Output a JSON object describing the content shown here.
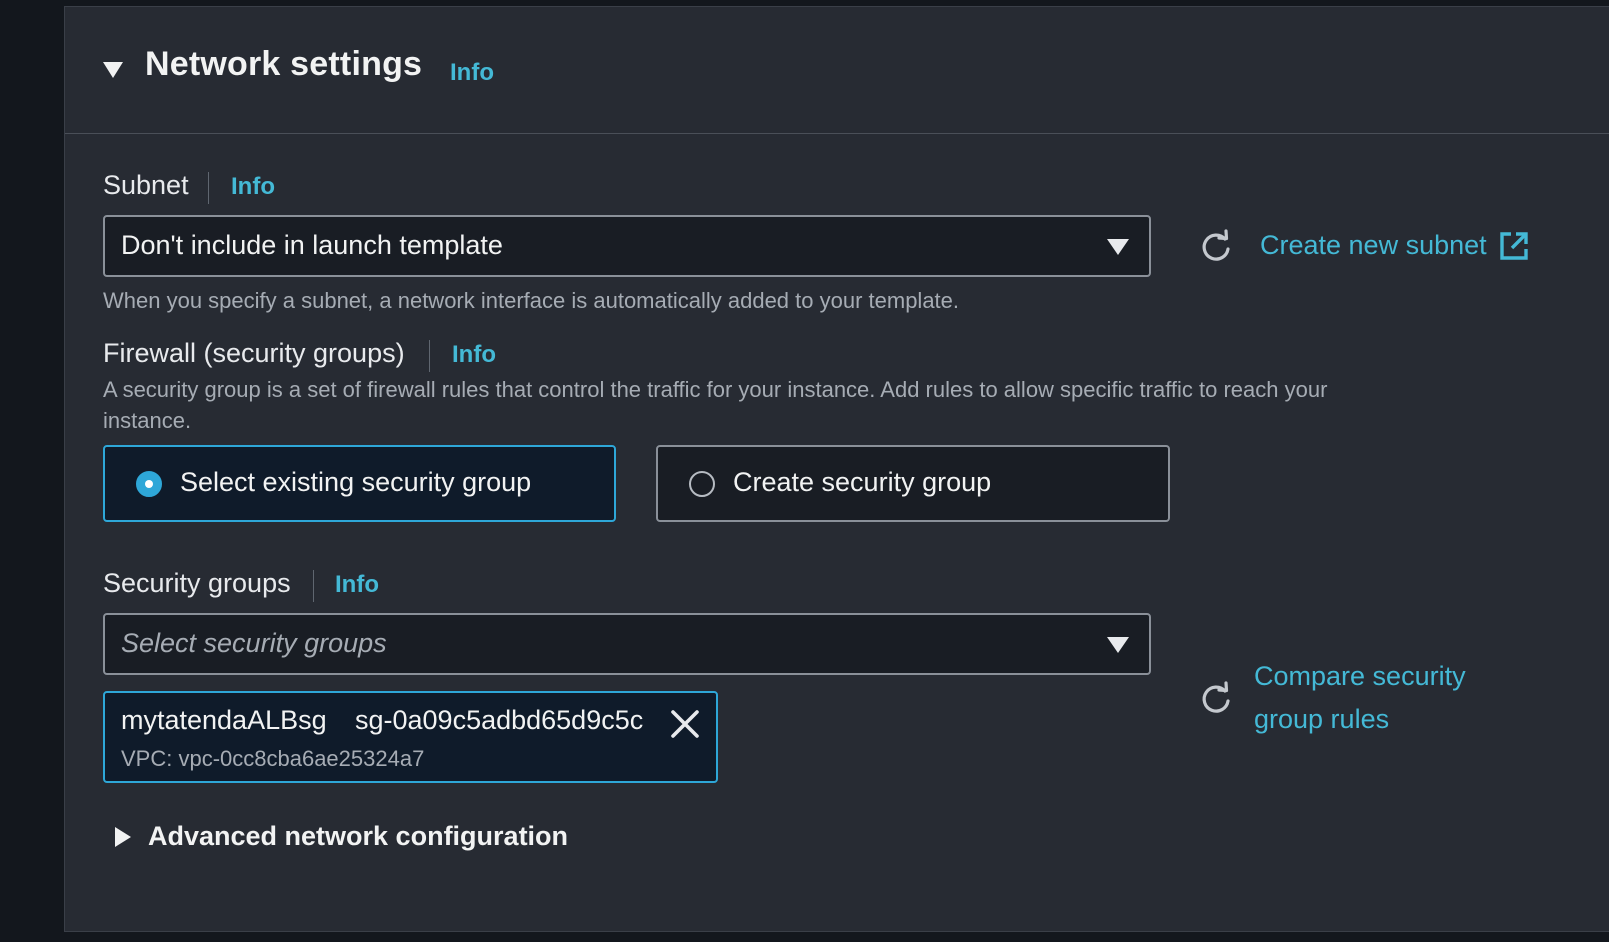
{
  "section": {
    "title": "Network settings",
    "info": "Info"
  },
  "subnet": {
    "label": "Subnet",
    "info": "Info",
    "value": "Don't include in launch template",
    "create_link": "Create new subnet",
    "help": "When you specify a subnet, a network interface is automatically added to your template."
  },
  "firewall": {
    "label": "Firewall (security groups)",
    "info": "Info",
    "description_line1": "A security group is a set of firewall rules that control the traffic for your instance. Add rules to allow specific traffic to reach your",
    "description_line2": "instance.",
    "options": [
      {
        "label": "Select existing security group",
        "selected": true
      },
      {
        "label": "Create security group",
        "selected": false
      }
    ]
  },
  "security_groups": {
    "label": "Security groups",
    "info": "Info",
    "placeholder": "Select security groups",
    "compare_link_line1": "Compare security",
    "compare_link_line2": "group rules",
    "tokens": [
      {
        "name": "mytatendaALBsg",
        "id": "sg-0a09c5adbd65d9c5c",
        "vpc": "VPC: vpc-0cc8cba6ae25324a7"
      }
    ]
  },
  "advanced": {
    "label": "Advanced network configuration"
  },
  "colors": {
    "link": "#44b9d6",
    "selected_border": "#2ea7d8",
    "panel_bg": "#272b33"
  }
}
